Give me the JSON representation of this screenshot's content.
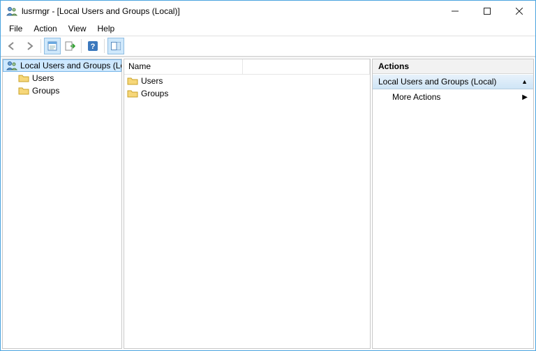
{
  "window": {
    "title": "lusrmgr - [Local Users and Groups (Local)]"
  },
  "menu": {
    "file": "File",
    "action": "Action",
    "view": "View",
    "help": "Help"
  },
  "toolbar": {
    "back": "back-icon",
    "forward": "forward-icon",
    "properties": "properties-icon",
    "export": "export-icon",
    "help": "help-icon",
    "showhide": "showhide-icon"
  },
  "tree": {
    "root": "Local Users and Groups (Local)",
    "children": [
      {
        "label": "Users"
      },
      {
        "label": "Groups"
      }
    ]
  },
  "list": {
    "columns": {
      "name": "Name"
    },
    "rows": [
      {
        "name": "Users"
      },
      {
        "name": "Groups"
      }
    ]
  },
  "actions": {
    "header": "Actions",
    "section": "Local Users and Groups (Local)",
    "more": "More Actions"
  }
}
